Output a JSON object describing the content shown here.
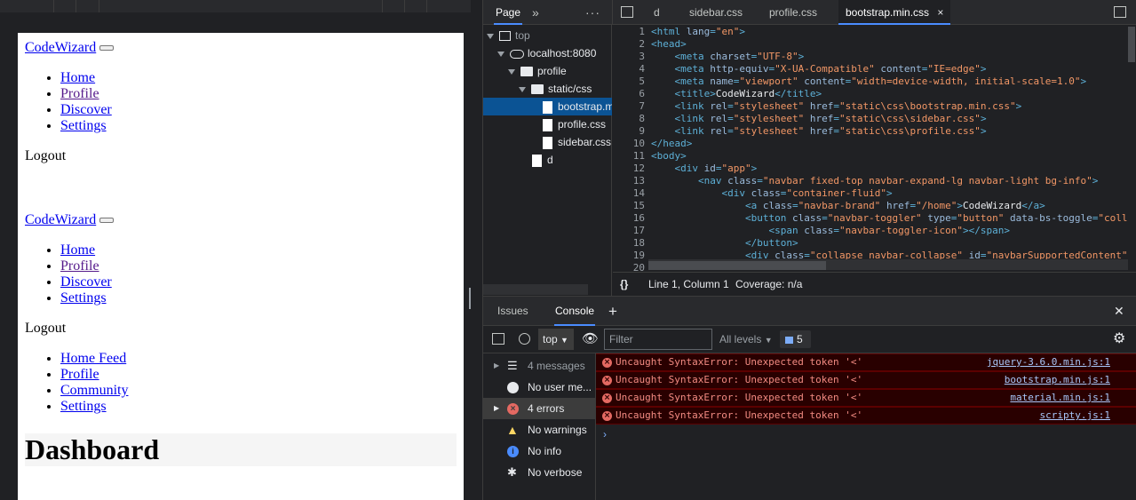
{
  "page": {
    "brand": "CodeWizard",
    "nav1": [
      "Home",
      "Profile",
      "Discover",
      "Settings"
    ],
    "logout1": "Logout",
    "brand2": "CodeWizard",
    "nav2": [
      "Home",
      "Profile",
      "Discover",
      "Settings"
    ],
    "logout2": "Logout",
    "sidebar_links": [
      "Home Feed",
      "Profile",
      "Community",
      "Settings"
    ],
    "heading": "Dashboard"
  },
  "devtools": {
    "sources_tab": "Page",
    "more_tabs": "»",
    "more_menu": "⋮",
    "file_tabs": [
      "d",
      "sidebar.css",
      "profile.css",
      "bootstrap.min.css"
    ],
    "close_tab": "×",
    "tree": {
      "top": "top",
      "host": "localhost:8080",
      "folder1": "profile",
      "folder2": "static/css",
      "file1": "bootstrap.min.css",
      "file2": "profile.css",
      "file3": "sidebar.css",
      "file4": "d"
    },
    "code_lines": [
      "1",
      "2",
      "3",
      "4",
      "5",
      "6",
      "7",
      "8",
      "9",
      "10",
      "11",
      "12",
      "13",
      "14",
      "15",
      "16",
      "17",
      "18",
      "19",
      "20"
    ],
    "status": {
      "braces": "{}",
      "position": "Line 1, Column 1",
      "coverage": "Coverage: n/a"
    },
    "drawer_tabs": [
      "Issues",
      "Console"
    ],
    "add_tab": "+",
    "close_drawer": "✕",
    "console": {
      "context": "top",
      "filter_placeholder": "Filter",
      "levels": "All levels",
      "badge_count": "5",
      "sidebar": [
        "4 messages",
        "No user me...",
        "4 errors",
        "No warnings",
        "No info",
        "No verbose"
      ],
      "errors": [
        {
          "text": "Uncaught SyntaxError: Unexpected token '<'",
          "source": "jquery-3.6.0.min.js:1"
        },
        {
          "text": "Uncaught SyntaxError: Unexpected token '<'",
          "source": "bootstrap.min.js:1"
        },
        {
          "text": "Uncaught SyntaxError: Unexpected token '<'",
          "source": "material.min.js:1"
        },
        {
          "text": "Uncaught SyntaxError: Unexpected token '<'",
          "source": "scripty.js:1"
        }
      ],
      "prompt": "›"
    },
    "colors": {
      "accent": "#4a8cff",
      "error_bg": "#290000",
      "error_text": "#f28b82",
      "selection": "#0b5394"
    }
  },
  "code": {
    "l1": "<html lang=\"en\">",
    "l2": "<head>",
    "l3": "    <meta charset=\"UTF-8\">",
    "l4": "    <meta http-equiv=\"X-UA-Compatible\" content=\"IE=edge\">",
    "l5": "    <meta name=\"viewport\" content=\"width=device-width, initial-scale=1.0\">",
    "l6": "    <title>CodeWizard</title>",
    "l7": "    <link rel=\"stylesheet\" href=\"static\\css\\bootstrap.min.css\">",
    "l8": "    <link rel=\"stylesheet\" href=\"static\\css\\sidebar.css\">",
    "l9": "    <link rel=\"stylesheet\" href=\"static\\css\\profile.css\">",
    "l10": "</head>",
    "l11": "<body>",
    "l12": "    <div id=\"app\">",
    "l13": "        <nav class=\"navbar fixed-top navbar-expand-lg navbar-light bg-info\">",
    "l14": "            <div class=\"container-fluid\">",
    "l15": "                <a class=\"navbar-brand\" href=\"/home\">CodeWizard</a>",
    "l16": "                <button class=\"navbar-toggler\" type=\"button\" data-bs-toggle=\"coll",
    "l17": "                    <span class=\"navbar-toggler-icon\"></span>",
    "l18": "                </button>",
    "l19": "                <div class=\"collapse navbar-collapse\" id=\"navbarSupportedContent\"",
    "l20": ""
  }
}
